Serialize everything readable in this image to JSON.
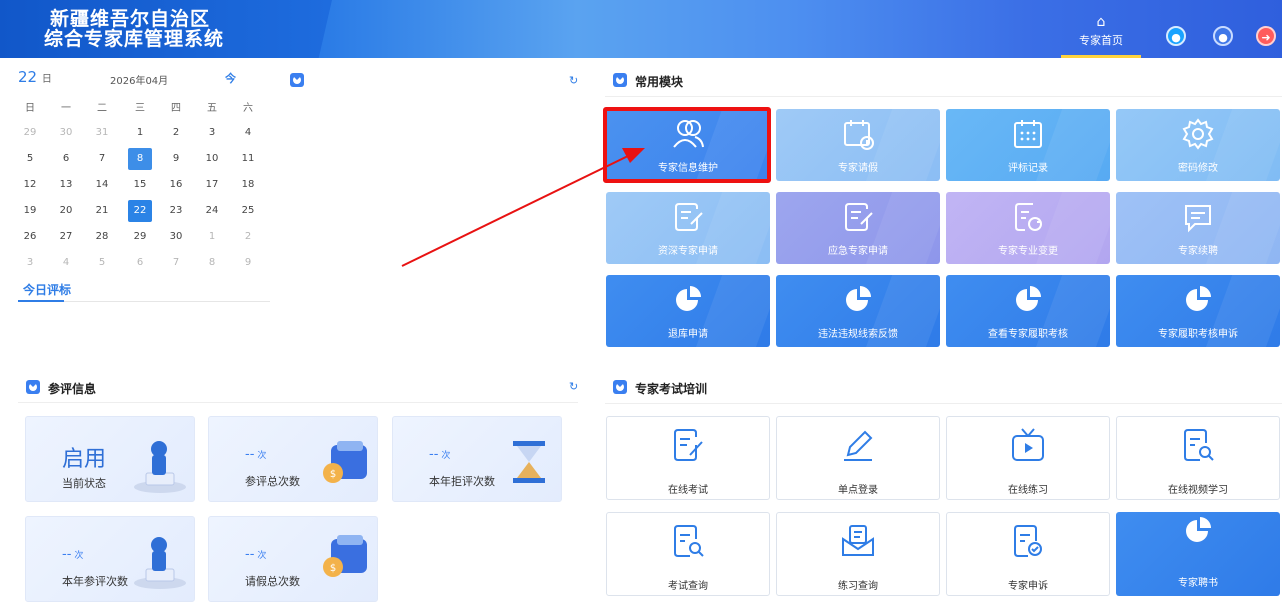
{
  "header": {
    "title_line1": "新疆维吾尔自治区",
    "title_line2": "综合专家库管理系统",
    "home_label": "专家首页",
    "home_icon": "home-icon",
    "actions": [
      "bell-icon",
      "user-icon",
      "logout-icon"
    ]
  },
  "calendar": {
    "day": "22",
    "day_unit": "日",
    "month": "2026年04月",
    "today_btn": "今",
    "weekdays": [
      "日",
      "一",
      "二",
      "三",
      "四",
      "五",
      "六"
    ],
    "weeks": [
      [
        "29",
        "30",
        "31",
        "1",
        "2",
        "3",
        "4"
      ],
      [
        "5",
        "6",
        "7",
        "8",
        "9",
        "10",
        "11"
      ],
      [
        "12",
        "13",
        "14",
        "15",
        "16",
        "17",
        "18"
      ],
      [
        "19",
        "20",
        "21",
        "22",
        "23",
        "24",
        "25"
      ],
      [
        "26",
        "27",
        "28",
        "29",
        "30",
        "1",
        "2"
      ],
      [
        "3",
        "4",
        "5",
        "6",
        "7",
        "8",
        "9"
      ]
    ],
    "today_tab": "今日评标"
  },
  "common": {
    "title": "常用模块",
    "tiles": [
      {
        "label": "专家信息维护",
        "icon": "users-icon"
      },
      {
        "label": "专家请假",
        "icon": "calendar-clock-icon"
      },
      {
        "label": "评标记录",
        "icon": "calendar-grid-icon"
      },
      {
        "label": "密码修改",
        "icon": "gear-icon"
      },
      {
        "label": "资深专家申请",
        "icon": "form-edit-icon"
      },
      {
        "label": "应急专家申请",
        "icon": "form-edit-icon"
      },
      {
        "label": "专家专业变更",
        "icon": "form-refresh-icon"
      },
      {
        "label": "专家续聘",
        "icon": "chat-icon"
      },
      {
        "label": "退库申请",
        "icon": "pie-chart-icon"
      },
      {
        "label": "违法违规线索反馈",
        "icon": "pie-chart-icon"
      },
      {
        "label": "查看专家履职考核",
        "icon": "pie-chart-icon"
      },
      {
        "label": "专家履职考核申诉",
        "icon": "pie-chart-icon"
      }
    ]
  },
  "participation": {
    "title": "参评信息",
    "cards": [
      {
        "value": "启用",
        "label": "当前状态"
      },
      {
        "value": "--",
        "unit": "次",
        "label": "参评总次数"
      },
      {
        "value": "--",
        "unit": "次",
        "label": "本年拒评次数"
      },
      {
        "value": "--",
        "unit": "次",
        "label": "本年参评次数"
      },
      {
        "value": "--",
        "unit": "次",
        "label": "请假总次数"
      }
    ]
  },
  "exam": {
    "title": "专家考试培训",
    "tiles": [
      {
        "label": "在线考试",
        "icon": "exam-edit-icon"
      },
      {
        "label": "单点登录",
        "icon": "pen-icon"
      },
      {
        "label": "在线练习",
        "icon": "tv-play-icon"
      },
      {
        "label": "在线视频学习",
        "icon": "doc-search-icon"
      },
      {
        "label": "考试查询",
        "icon": "doc-search-icon"
      },
      {
        "label": "练习查询",
        "icon": "envelope-doc-icon"
      },
      {
        "label": "专家申诉",
        "icon": "doc-check-icon"
      },
      {
        "label": "专家聘书",
        "icon": "pie-chart-icon"
      }
    ]
  },
  "colors": {
    "primary": "#2f7de6",
    "highlight": "#ee1111"
  }
}
